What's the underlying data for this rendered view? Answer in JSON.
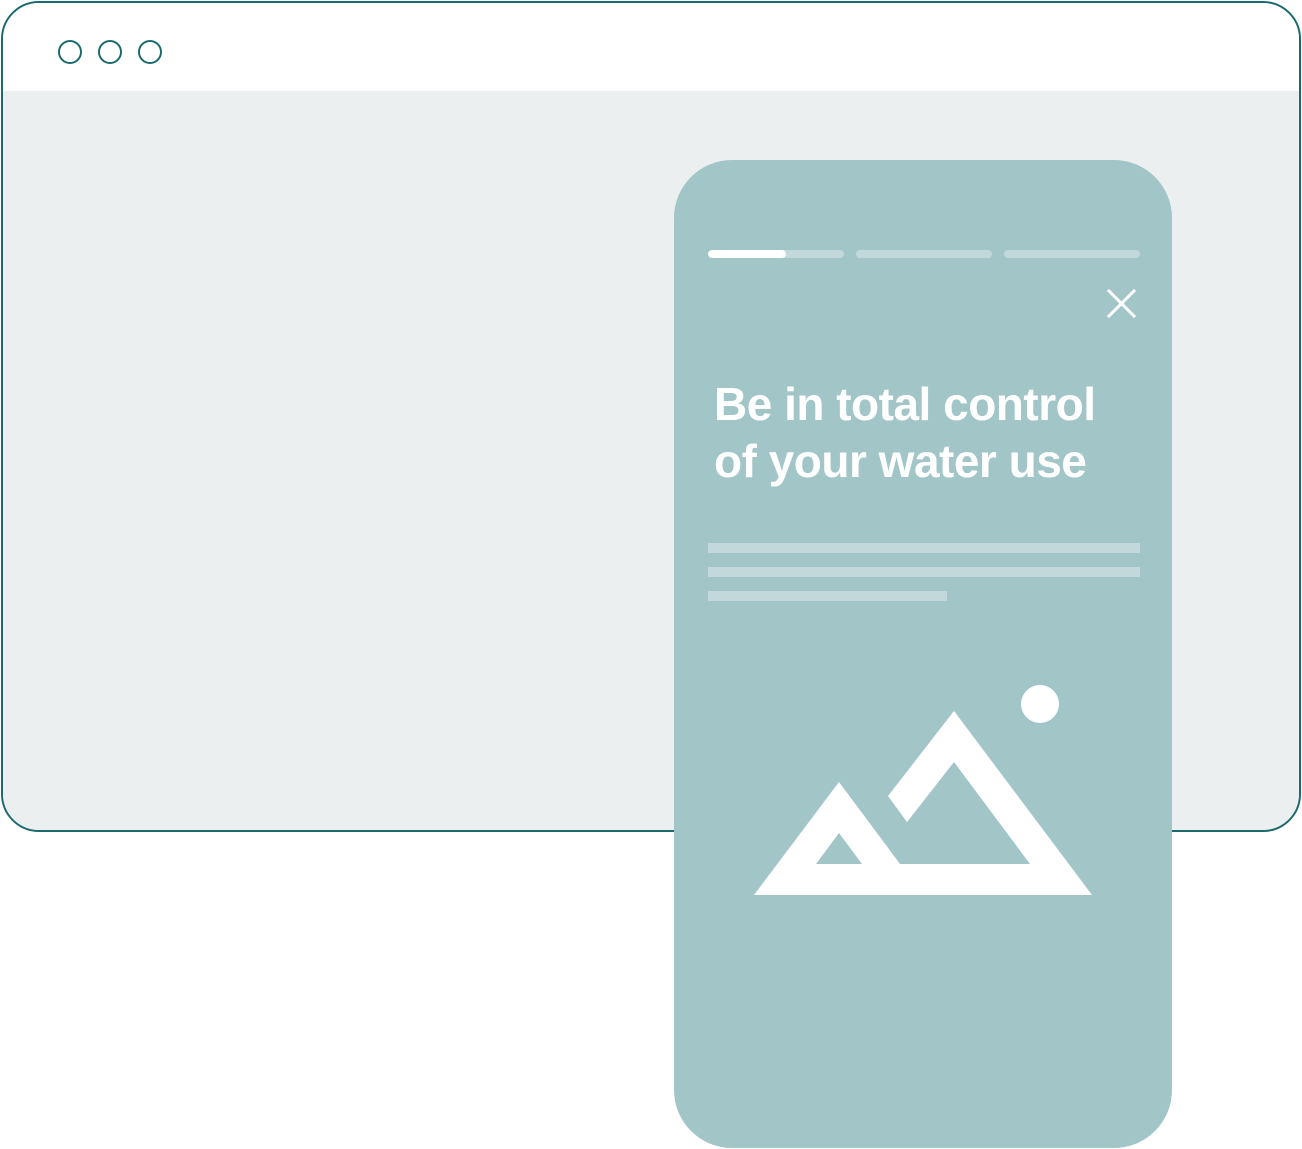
{
  "window": {
    "controls": [
      {
        "name": "window-dot-1"
      },
      {
        "name": "window-dot-2"
      },
      {
        "name": "window-dot-3"
      }
    ]
  },
  "story": {
    "progress": {
      "segments": 3,
      "current_index": 0,
      "current_fraction": 0.57
    },
    "close_icon": "close-icon",
    "headline": "Be in total control of your water use",
    "image_icon": "image-placeholder-icon"
  },
  "colors": {
    "frame_border": "#1d6a6e",
    "browser_background": "#ebeff0",
    "card_background": "#a2c6c8",
    "placeholder": "#c3d8da",
    "foreground": "#ffffff"
  }
}
